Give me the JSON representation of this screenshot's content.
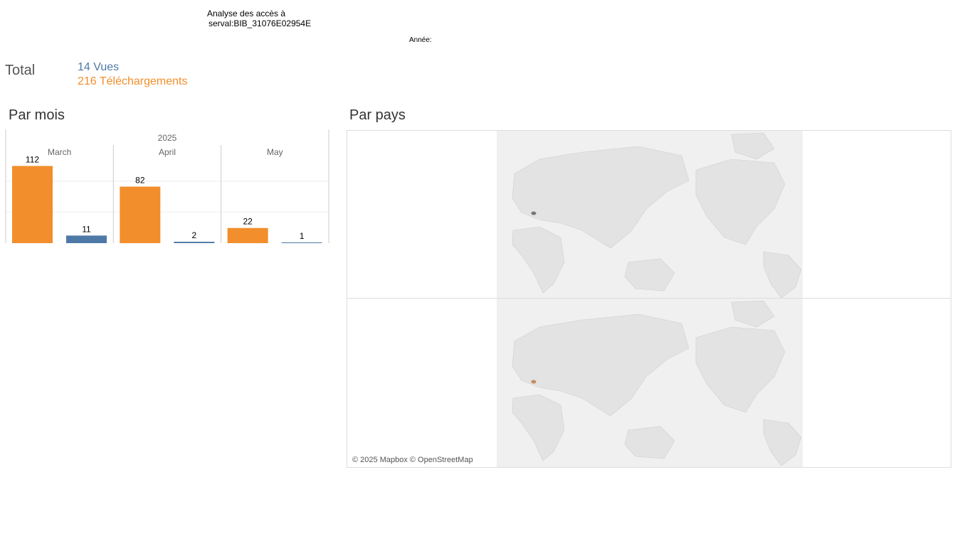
{
  "header": {
    "title_line1": "Analyse des accès à",
    "title_line2": "serval:BIB_31076E02954E",
    "year_label": "Année:"
  },
  "totals": {
    "label": "Total",
    "views": "14 Vues",
    "downloads": "216 Téléchargements"
  },
  "sections": {
    "by_month": "Par mois",
    "by_country": "Par pays"
  },
  "colors": {
    "downloads": "#f28e2b",
    "views": "#4e79a7"
  },
  "chart_data": {
    "type": "bar",
    "year": "2025",
    "categories": [
      "March",
      "April",
      "May"
    ],
    "series": [
      {
        "values": [
          112,
          82,
          22
        ]
      },
      {
        "values": [
          11,
          2,
          1
        ]
      }
    ],
    "ylim": [
      0,
      130
    ],
    "grid": true
  },
  "maps": {
    "attribution": "© 2025 Mapbox © OpenStreetMap",
    "panels": [
      {
        "highlight": "Switzerland",
        "highlight_color": "#777777"
      },
      {
        "highlight": "Switzerland",
        "highlight_color": "#c58a5a"
      }
    ]
  }
}
